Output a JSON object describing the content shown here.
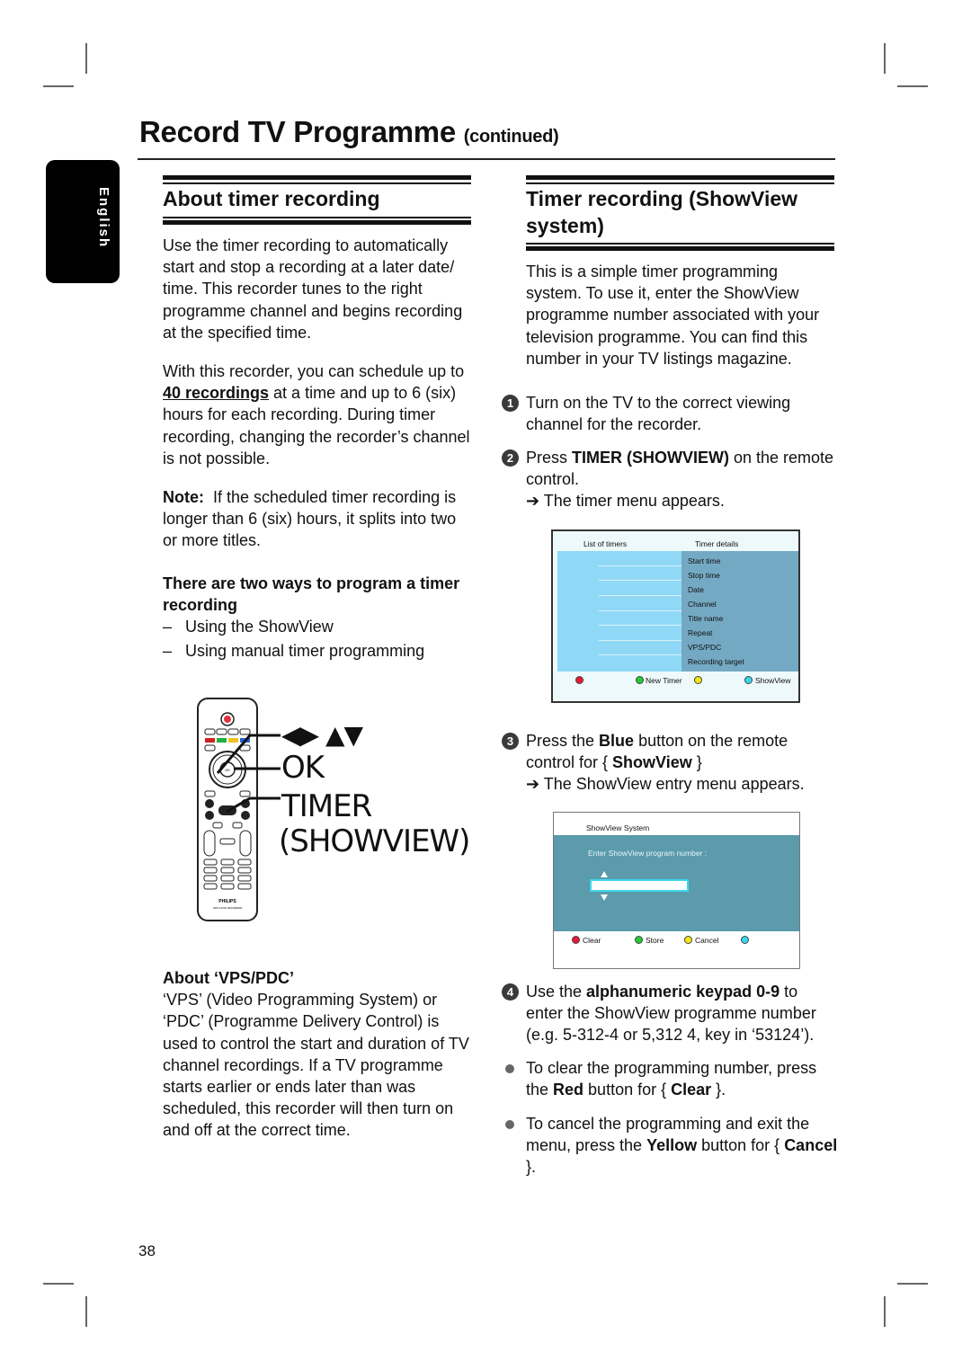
{
  "page": {
    "title": "Record TV Programme",
    "title_suffix": "(continued)",
    "language_tab": "English",
    "page_number": "38"
  },
  "left_column": {
    "heading": "About timer recording",
    "intro": "Use the timer recording to automatically start and stop a recording at a later date/ time. This recorder tunes to the right programme channel and begins recording at the specified time.",
    "schedule_pre": "With this recorder, you can schedule up to ",
    "schedule_highlight": "40 recordings",
    "schedule_post": " at a time and up to 6 (six) hours for each recording.  During timer recording, changing the recorder’s channel is not possible.",
    "note_label": "Note:",
    "note_text": "  If the scheduled timer recording is longer than 6 (six) hours, it splits into two or more titles.",
    "ways_heading": "There are two ways to program a timer recording",
    "ways": [
      {
        "dash": "–",
        "text": "Using the ShowView"
      },
      {
        "dash": "–",
        "text": "Using manual timer programming"
      }
    ],
    "remote_callouts": {
      "arrows": "◀▶ ▲▼",
      "ok": "OK",
      "timer": "TIMER",
      "showview": "(SHOWVIEW)"
    },
    "remote": {
      "brand": "PHILIPS",
      "model": "HDD & DVD RECORDER",
      "ok_label": "OK"
    },
    "vps_heading": "About ‘VPS/PDC’",
    "vps_text": "‘VPS’ (Video Programming System) or ‘PDC’ (Programme Delivery Control) is used to control the start and duration of TV channel recordings. If a TV programme starts earlier or ends later than was scheduled, this recorder will then turn on and off at the correct time."
  },
  "right_column": {
    "heading": "Timer recording (ShowView system)",
    "intro": "This is a simple timer programming system. To use it, enter the ShowView programme number associated with your television programme. You can find this number in your TV listings magazine.",
    "steps": [
      {
        "num": "1",
        "text": "Turn on the TV to the correct viewing channel for the recorder."
      },
      {
        "num": "2",
        "pre": "Press ",
        "bold": "TIMER (SHOWVIEW)",
        "post": " on the remote control.",
        "result": "The timer menu appears."
      },
      {
        "num": "3",
        "pre": "Press the ",
        "bold": "Blue",
        "mid": " button on the remote control for { ",
        "bold2": "ShowView",
        "post": " }",
        "result": "The ShowView entry menu appears."
      },
      {
        "num": "4",
        "pre": "Use the ",
        "bold": "alphanumeric keypad 0-9",
        "post": " to enter the ShowView programme number (e.g. 5-312-4 or 5,312 4, key in ‘53124’)."
      }
    ],
    "arrow_glyph": "➔",
    "bullets": [
      {
        "pre": "To clear the programming number, press the ",
        "bold": "Red",
        "mid": " button for { ",
        "bold2": "Clear",
        "post": " }."
      },
      {
        "pre": "To cancel the programming and exit the menu, press the ",
        "bold": "Yellow",
        "mid": " button for { ",
        "bold2": "Cancel",
        "post": " }."
      }
    ]
  },
  "timer_menu": {
    "list_header": "List of timers",
    "details_header": "Timer details",
    "details": [
      "Start time",
      "Stop time",
      "Date",
      "Channel",
      "Title name",
      "Repeat",
      "VPS/PDC",
      "Recording target"
    ],
    "footer": [
      {
        "color": "#e8173a",
        "label": ""
      },
      {
        "color": "#22cc33",
        "label": "New Timer"
      },
      {
        "color": "#f5e60f",
        "label": ""
      },
      {
        "color": "#33d9ee",
        "label": "ShowView"
      }
    ]
  },
  "showview_menu": {
    "title": "ShowView System",
    "prompt": "Enter ShowView program number :",
    "input_value": "",
    "footer": [
      {
        "color": "#e8173a",
        "label": "Clear"
      },
      {
        "color": "#22cc33",
        "label": "Store"
      },
      {
        "color": "#f5e60f",
        "label": "Cancel"
      },
      {
        "color": "#33d9ee",
        "label": ""
      }
    ]
  }
}
